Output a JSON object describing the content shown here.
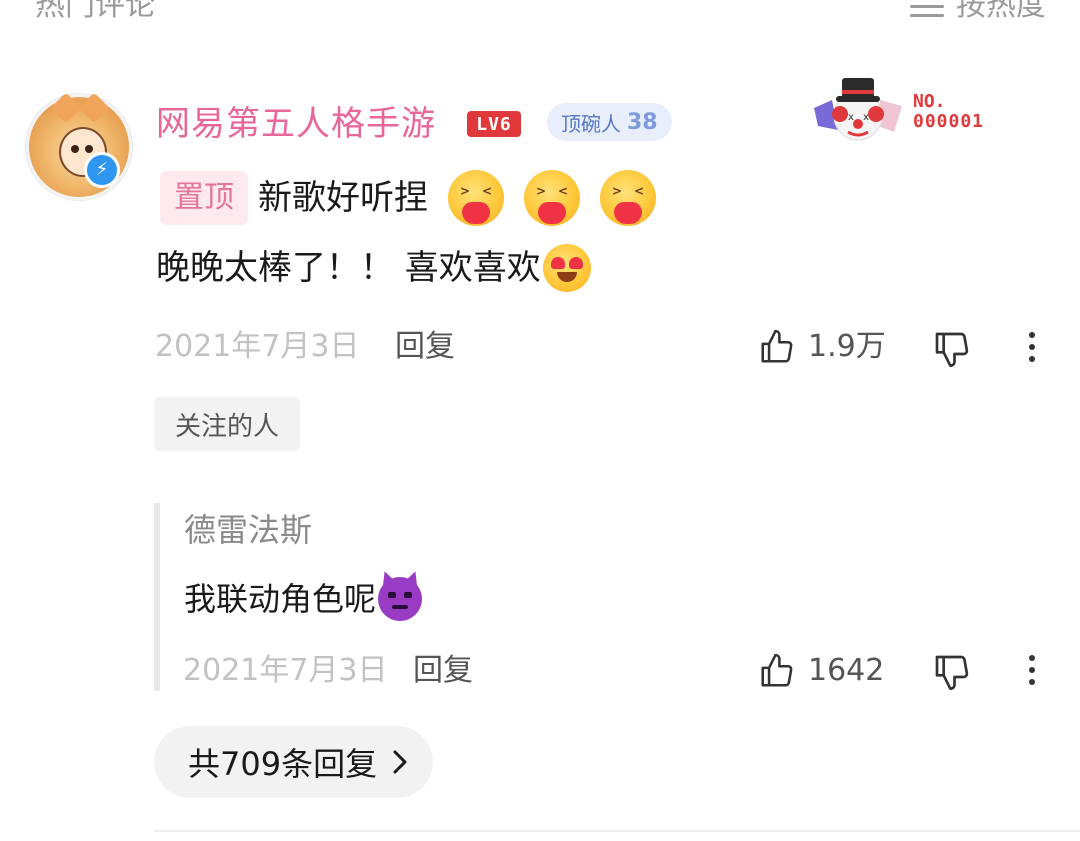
{
  "section_title": "热门评论",
  "sort": {
    "label": "按热度",
    "icon": "menu-lines-icon"
  },
  "comment": {
    "author": "网易第五人格手游",
    "level_badge": "LV6",
    "title_badge": {
      "label": "顶碗人",
      "number": "38"
    },
    "collectible_badge": {
      "line1": "NO.",
      "line2": "000001",
      "icon": "clown-icon"
    },
    "pin_tag": "置顶",
    "text_line1": "新歌好听捏",
    "text_line2": "晚晚太棒了！！ 喜欢喜欢",
    "emojis_line1": [
      "hug-heart-emoji",
      "hug-heart-emoji",
      "hug-heart-emoji"
    ],
    "emoji_line2": "heart-eyes-emoji",
    "date": "2021年7月3日",
    "reply_label": "回复",
    "like_count": "1.9万",
    "followed_tag": "关注的人"
  },
  "reply": {
    "author": "德雷法斯",
    "text": "我联动角色呢",
    "emoji": "devil-emoji",
    "date": "2021年7月3日",
    "reply_label": "回复",
    "like_count": "1642"
  },
  "more_replies": "共709条回复",
  "colors": {
    "author_pink": "#e8669a",
    "level_red": "#e0393b",
    "title_badge_bg": "#e8eefb",
    "title_badge_text": "#5778c6",
    "pin_bg": "#fde9ee",
    "pin_text": "#e47597",
    "muted_gray": "#c2c2c2"
  }
}
